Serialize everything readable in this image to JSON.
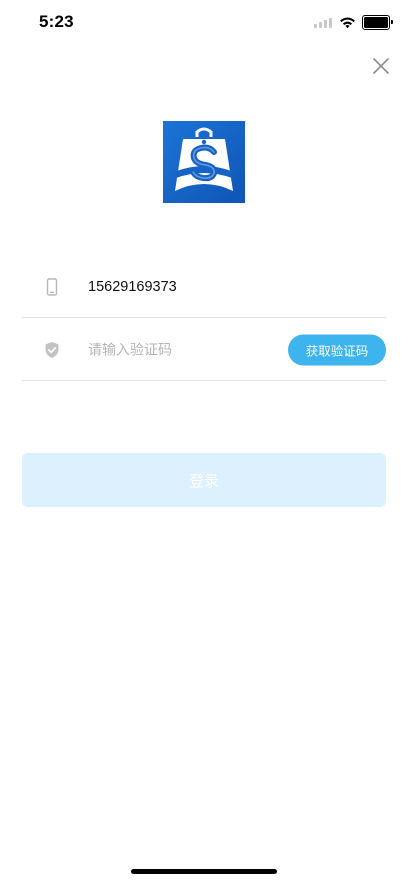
{
  "status_bar": {
    "time": "5:23",
    "icons": [
      "cellular-signal-icon",
      "wifi-icon",
      "battery-icon"
    ]
  },
  "header": {
    "close_icon": "close-icon"
  },
  "logo": {
    "icon": "app-logo-shopping-bag-s-icon",
    "colors": {
      "background": "#1663c6",
      "foreground": "#ffffff"
    }
  },
  "form": {
    "phone": {
      "icon": "mobile-phone-icon",
      "value": "15629169373"
    },
    "code": {
      "icon": "shield-check-icon",
      "placeholder": "请输入验证码",
      "value": "",
      "get_code_label": "获取验证码"
    }
  },
  "login": {
    "label": "登录"
  },
  "colors": {
    "accent": "#3db4ed",
    "login_disabled": "#dcf0fd",
    "divider": "#e3e3e3",
    "placeholder": "#b5b5b5"
  }
}
